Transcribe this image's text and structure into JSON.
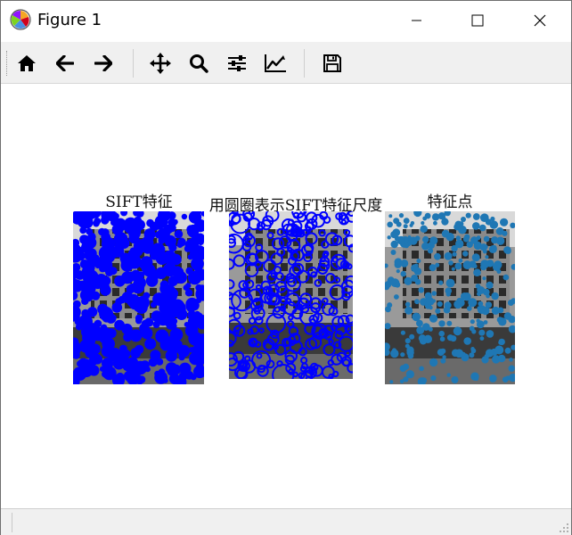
{
  "window": {
    "title": "Figure 1"
  },
  "toolbar": {
    "buttons": [
      {
        "icon": "home-icon"
      },
      {
        "icon": "arrow-left-icon"
      },
      {
        "icon": "arrow-right-icon"
      },
      {
        "icon": "move-icon"
      },
      {
        "icon": "zoom-icon"
      },
      {
        "icon": "sliders-icon"
      },
      {
        "icon": "chart-edit-icon"
      },
      {
        "icon": "save-icon"
      }
    ]
  },
  "figure": {
    "subplots": [
      {
        "title": "SIFT特征",
        "marker_color": "#0000ff",
        "marker_style": "filled-dots"
      },
      {
        "title": "用圆圈表示SIFT特征尺度",
        "marker_color": "#0000ff",
        "marker_style": "circles"
      },
      {
        "title": "特征点",
        "marker_color": "#1f77b4",
        "marker_style": "filled-dots"
      }
    ]
  },
  "colors": {
    "toolbar_bg": "#f0f0f0",
    "accent_blue": "#0000ff",
    "tab_blue": "#1f77b4"
  }
}
